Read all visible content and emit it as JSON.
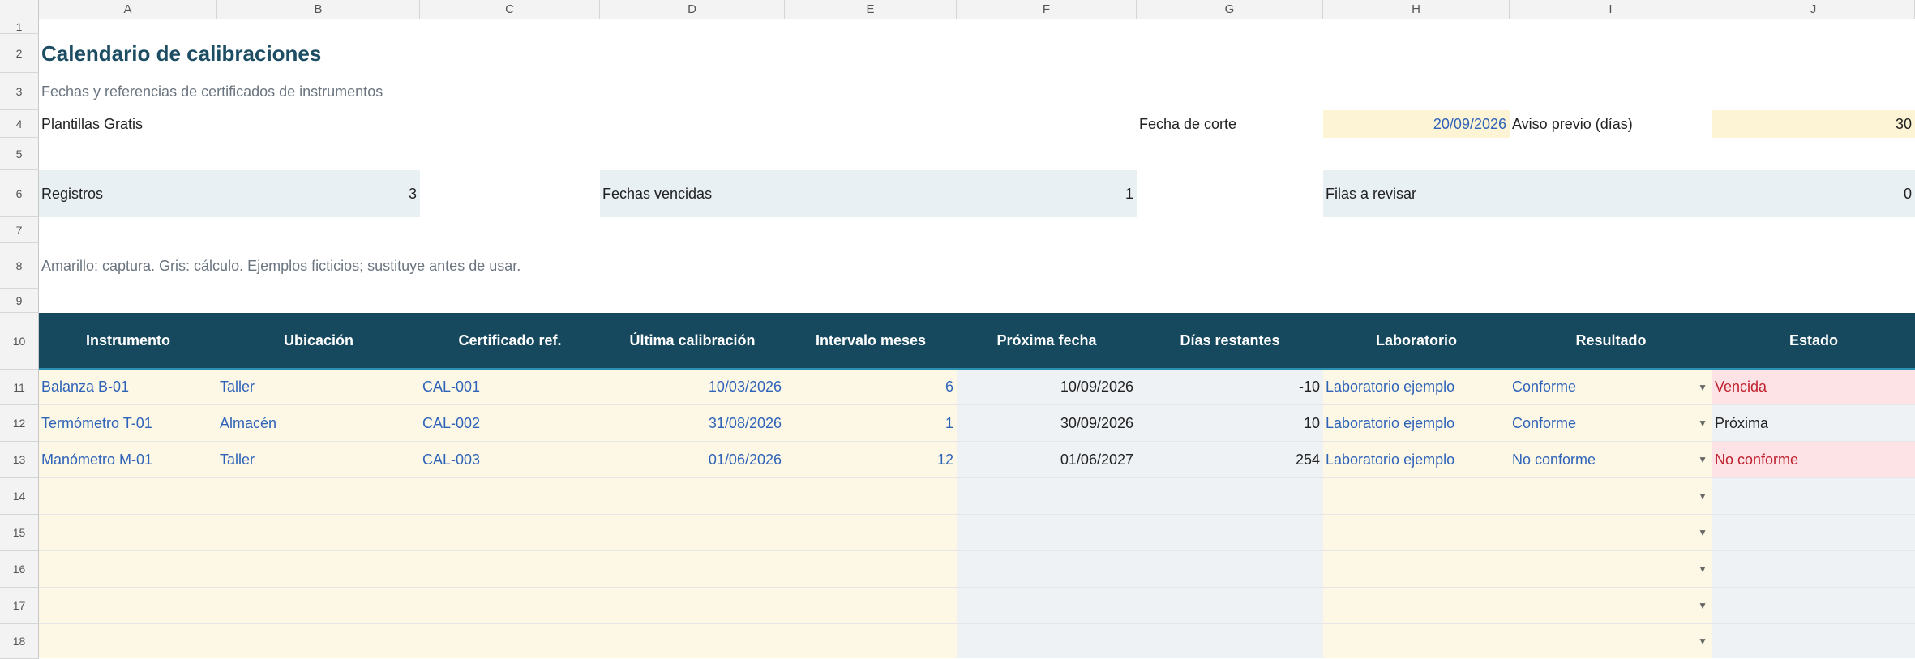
{
  "columns": [
    "A",
    "B",
    "C",
    "D",
    "E",
    "F",
    "G",
    "H",
    "I",
    "J"
  ],
  "rows": [
    "1",
    "2",
    "3",
    "4",
    "5",
    "6",
    "7",
    "8",
    "9",
    "10",
    "11",
    "12",
    "13",
    "14",
    "15",
    "16",
    "17",
    "18"
  ],
  "title": "Calendario de calibraciones",
  "subtitle": "Fechas y referencias de certificados de instrumentos",
  "brand": "Plantillas Gratis",
  "cutoff_label": "Fecha de corte",
  "cutoff_value": "20/09/2026",
  "notice_label": "Aviso previo (días)",
  "notice_value": "30",
  "kpis": [
    {
      "label": "Registros",
      "value": "3"
    },
    {
      "label": "Fechas vencidas",
      "value": "1"
    },
    {
      "label": "Filas a revisar",
      "value": "0"
    }
  ],
  "note": "Amarillo: captura. Gris: cálculo. Ejemplos ficticios; sustituye antes de usar.",
  "table_headers": [
    "Instrumento",
    "Ubicación",
    "Certificado ref.",
    "Última calibración",
    "Intervalo meses",
    "Próxima fecha",
    "Días restantes",
    "Laboratorio",
    "Resultado",
    "Estado"
  ],
  "table_rows": [
    [
      "Balanza B-01",
      "Taller",
      "CAL-001",
      "10/03/2026",
      "6",
      "10/09/2026",
      "-10",
      "Laboratorio ejemplo",
      "Conforme",
      "Vencida"
    ],
    [
      "Termómetro T-01",
      "Almacén",
      "CAL-002",
      "31/08/2026",
      "1",
      "30/09/2026",
      "10",
      "Laboratorio ejemplo",
      "Conforme",
      "Próxima"
    ],
    [
      "Manómetro M-01",
      "Taller",
      "CAL-003",
      "01/06/2026",
      "12",
      "01/06/2027",
      "254",
      "Laboratorio ejemplo",
      "No conforme",
      "No conforme"
    ]
  ],
  "dropdown_icon": "chevron-down-icon",
  "colors": {
    "header_bg": "#17495e",
    "input_bg": "#fdf8e6",
    "calc_bg": "#eef2f5",
    "alert_bg": "#fde3e6",
    "alert_text": "#c0212e",
    "input_text": "#2f63b8"
  }
}
